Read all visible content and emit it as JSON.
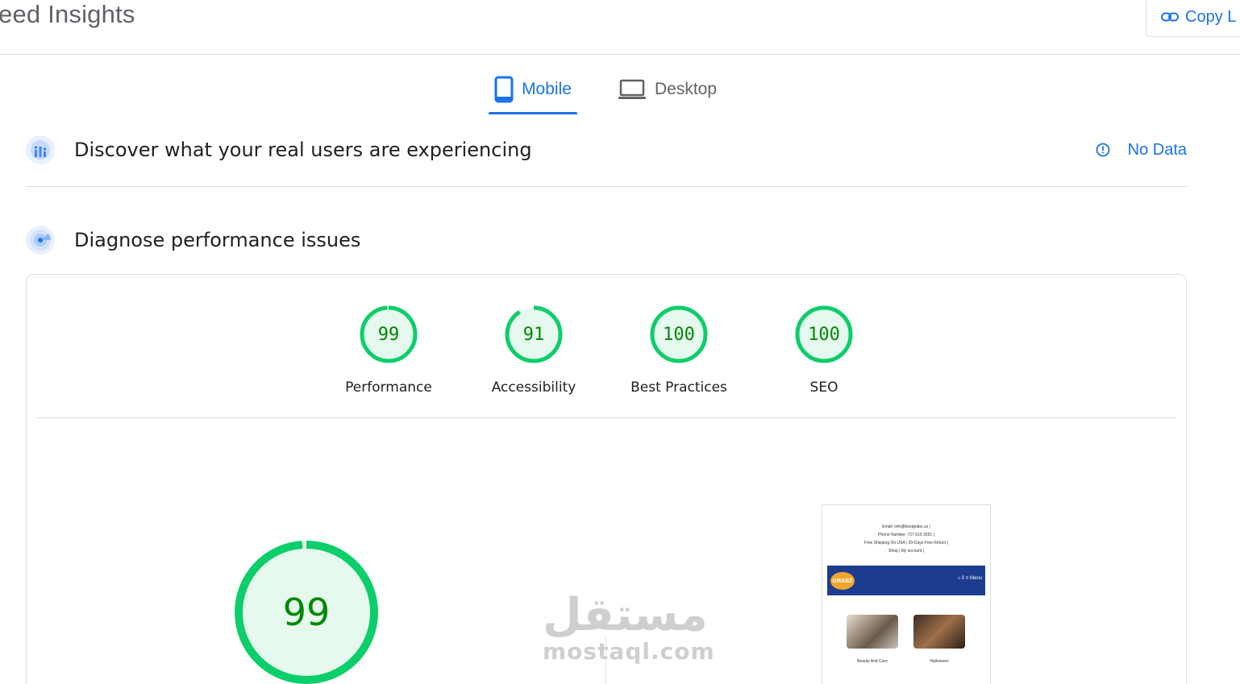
{
  "header": {
    "title": "eed Insights",
    "copy_label": "Copy L"
  },
  "tabs": [
    {
      "label": "Mobile",
      "active": true
    },
    {
      "label": "Desktop",
      "active": false
    }
  ],
  "real_users": {
    "title": "Discover what your real users are experiencing",
    "status": "No Data"
  },
  "diagnose": {
    "title": "Diagnose performance issues"
  },
  "scores": [
    {
      "value": "99",
      "label": "Performance",
      "fraction": 0.99
    },
    {
      "value": "91",
      "label": "Accessibility",
      "fraction": 0.91
    },
    {
      "value": "100",
      "label": "Best Practices",
      "fraction": 1.0
    },
    {
      "value": "100",
      "label": "SEO",
      "fraction": 1.0
    }
  ],
  "big_score": {
    "value": "99",
    "fraction": 0.99
  },
  "watermark": {
    "arabic": "مستقل",
    "latin": "mostaql.com"
  },
  "screenshot": {
    "email": "Email: info@bestgrabz.us |",
    "phone": "Phone Number: 727 615 3551 |",
    "shipping": "Free Shipping On USA |    30-Days Free Return |",
    "links": "Shop |    My account |",
    "logo": "GRABZ",
    "menu": "Menu",
    "cart_count": "0",
    "categories": [
      "Beauty And Care",
      "Halloween"
    ]
  },
  "colors": {
    "accent": "#1a73e8",
    "pass": "#0cce6b",
    "pass_text": "#008800",
    "pass_fill": "#e6f9ee"
  }
}
